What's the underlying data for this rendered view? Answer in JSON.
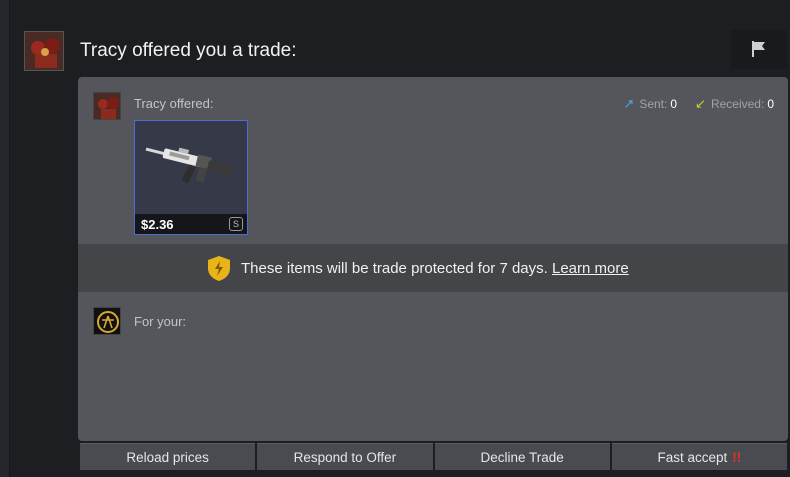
{
  "header": {
    "title": "Tracy offered you a trade:"
  },
  "offer": {
    "label": "Tracy offered:",
    "sent_label": "Sent:",
    "sent_count": "0",
    "received_label": "Received:",
    "received_count": "0",
    "items": [
      {
        "price": "$2.36",
        "badge": "S",
        "icon": "rifle-icon"
      }
    ]
  },
  "protection": {
    "text": "These items will be trade protected for 7 days.",
    "link": "Learn more"
  },
  "your": {
    "label": "For your:"
  },
  "buttons": {
    "reload": "Reload prices",
    "respond": "Respond to Offer",
    "decline": "Decline Trade",
    "fast_accept": "Fast accept",
    "fast_accept_mark": "!!"
  },
  "colors": {
    "sent_arrow": "#4aa8ee",
    "received_arrow": "#c9d135",
    "shield": "#e8b417",
    "item_border": "#4b6ed0"
  }
}
